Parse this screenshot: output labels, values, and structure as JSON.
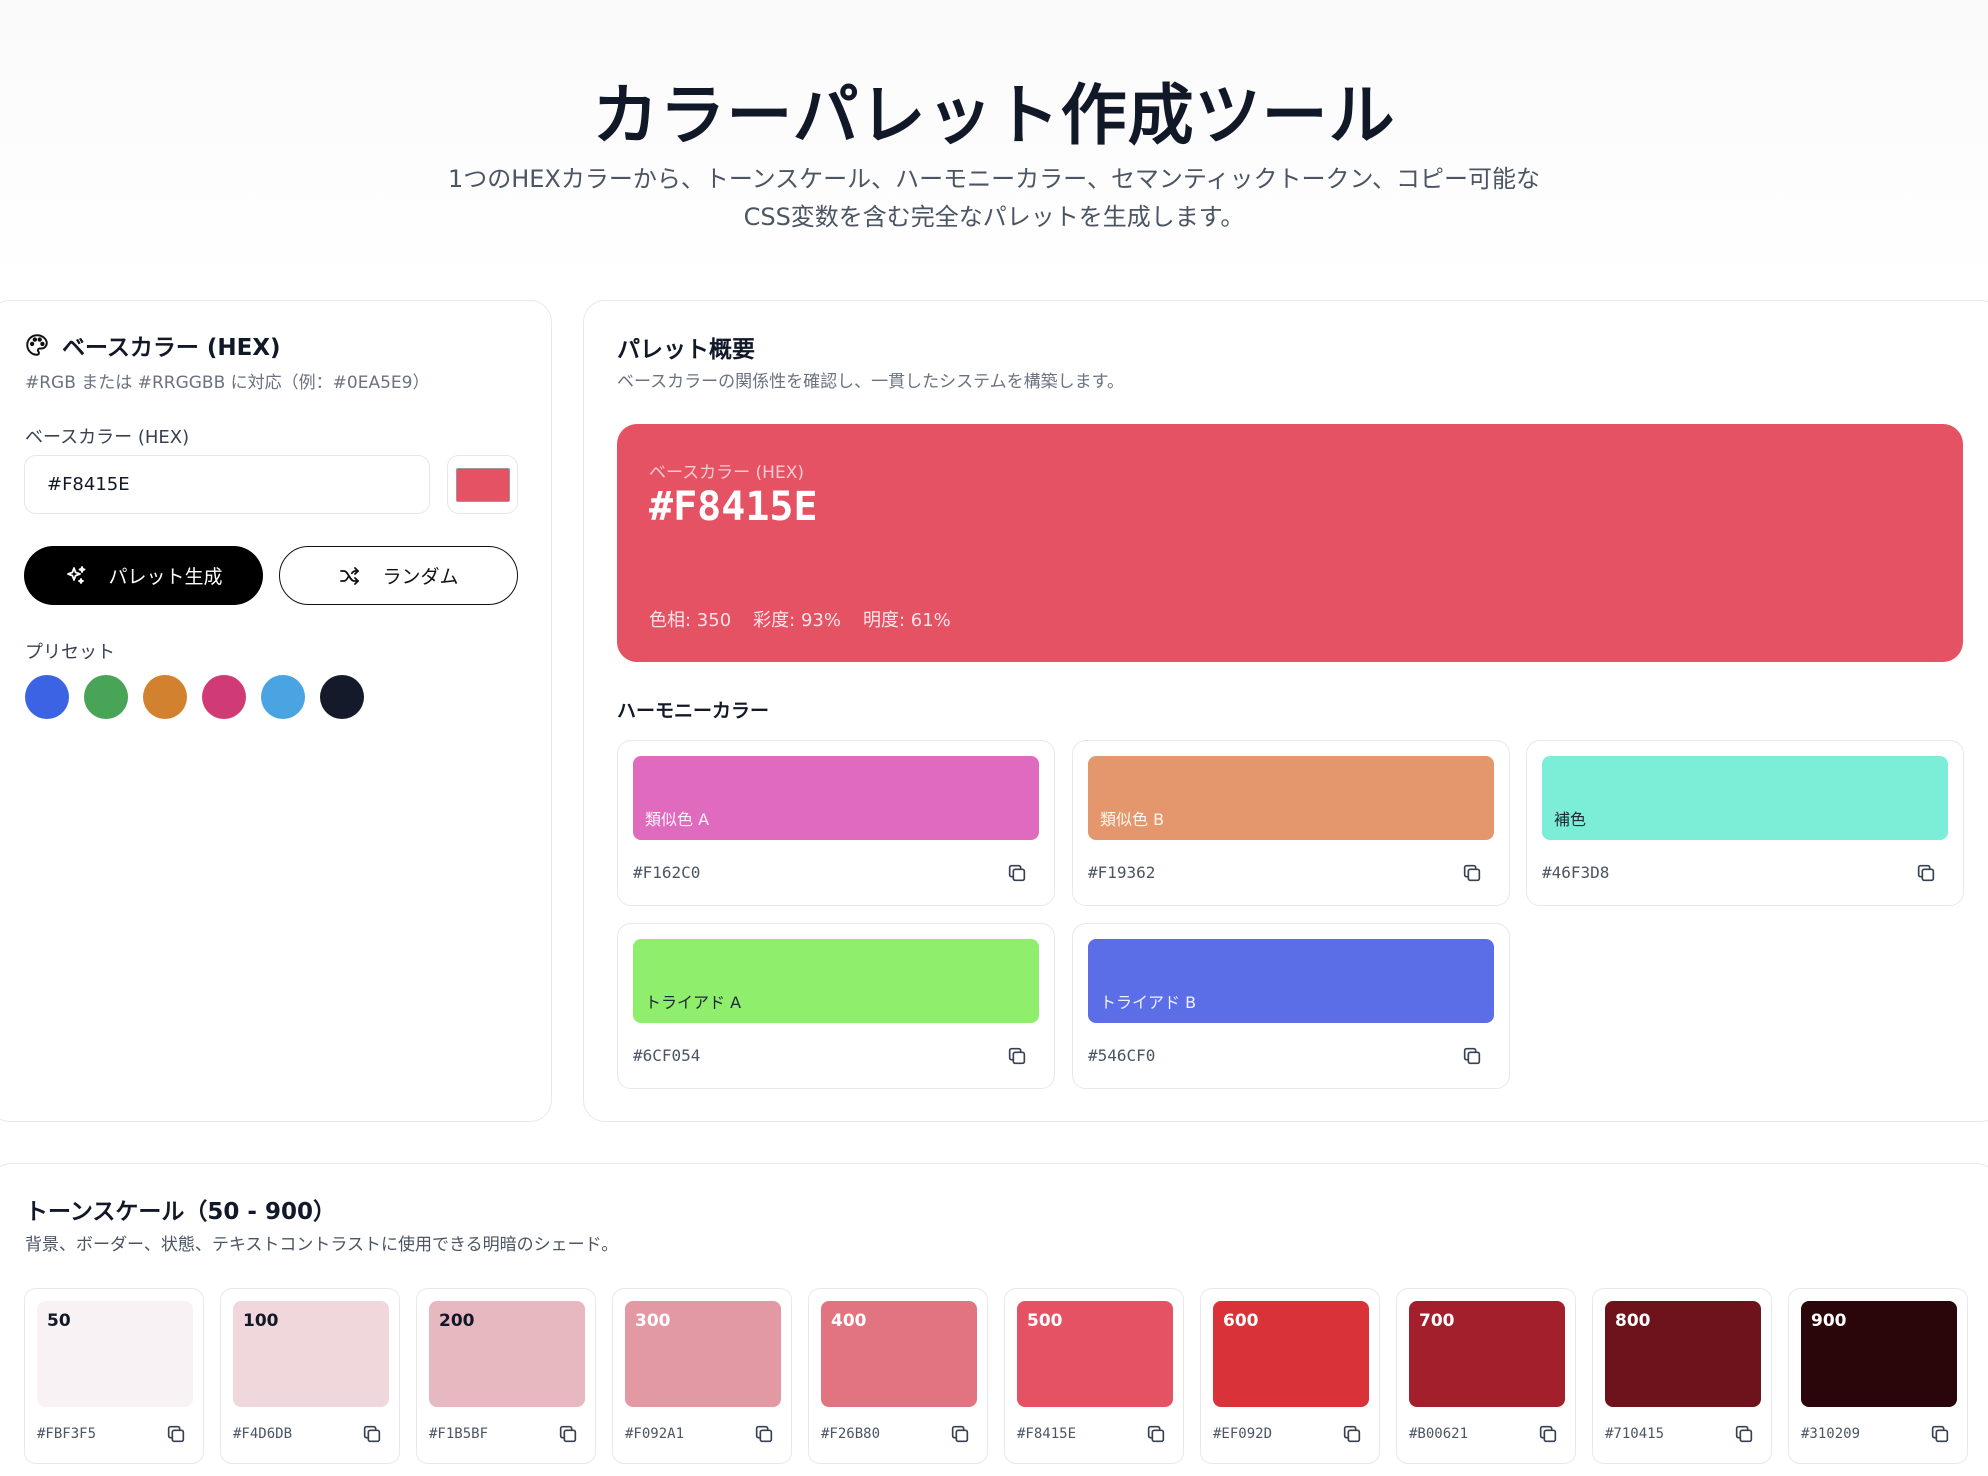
{
  "header": {
    "title": "カラーパレット作成ツール",
    "subtitle_line1": "1つのHEXカラーから、トーンスケール、ハーモニーカラー、セマンティックトークン、コピー可能な",
    "subtitle_line2": "CSS変数を含む完全なパレットを生成します。"
  },
  "input_panel": {
    "title": "ベースカラー (HEX)",
    "subtitle": "#RGB または #RRGGBB に対応（例：#0EA5E9）",
    "field_label": "ベースカラー (HEX)",
    "hex_value": "#F8415E",
    "generate_label": "パレット生成",
    "random_label": "ランダム",
    "presets_label": "プリセット",
    "presets": [
      "#3B63E3",
      "#48A456",
      "#D2812E",
      "#D03A75",
      "#4BA4E2",
      "#141A2A"
    ]
  },
  "overview": {
    "title": "パレット概要",
    "subtitle": "ベースカラーの関係性を確認し、一貫したシステムを構築します。",
    "base_label": "ベースカラー (HEX)",
    "base_hex": "#F8415E",
    "base_color": "#E55264",
    "hue": "色相: 350",
    "saturation": "彩度: 93%",
    "lightness": "明度: 61%"
  },
  "harmony": {
    "title": "ハーモニーカラー",
    "items": [
      {
        "label": "類似色 A",
        "hex": "#F162C0",
        "color": "#E06ABE",
        "text_color": "#fdf2fa"
      },
      {
        "label": "類似色 B",
        "hex": "#F19362",
        "color": "#E4976C",
        "text_color": "#fdf5ef"
      },
      {
        "label": "補色",
        "hex": "#46F3D8",
        "color": "#7CEED8",
        "text_color": "#1f2937"
      },
      {
        "label": "トライアド A",
        "hex": "#6CF054",
        "color": "#8FEE6C",
        "text_color": "#1f2937"
      },
      {
        "label": "トライアド B",
        "hex": "#546CF0",
        "color": "#5B6EE8",
        "text_color": "#eef0ff"
      }
    ]
  },
  "tone_scale": {
    "title": "トーンスケール（50 - 900）",
    "subtitle": "背景、ボーダー、状態、テキストコントラストに使用できる明暗のシェード。",
    "items": [
      {
        "step": "50",
        "hex": "#FBF3F5",
        "color": "#F9F2F4",
        "text_color": "#111827"
      },
      {
        "step": "100",
        "hex": "#F4D6DB",
        "color": "#F0D7DB",
        "text_color": "#111827"
      },
      {
        "step": "200",
        "hex": "#F1B5BF",
        "color": "#E8B8C0",
        "text_color": "#111827"
      },
      {
        "step": "300",
        "hex": "#F092A1",
        "color": "#E299A4",
        "text_color": "#ffffff"
      },
      {
        "step": "400",
        "hex": "#F26B80",
        "color": "#E27482",
        "text_color": "#ffffff"
      },
      {
        "step": "500",
        "hex": "#F8415E",
        "color": "#E55264",
        "text_color": "#ffffff"
      },
      {
        "step": "600",
        "hex": "#EF092D",
        "color": "#D93339",
        "text_color": "#ffffff"
      },
      {
        "step": "700",
        "hex": "#B00621",
        "color": "#A21F2B",
        "text_color": "#ffffff"
      },
      {
        "step": "800",
        "hex": "#710415",
        "color": "#6E131B",
        "text_color": "#ffffff"
      },
      {
        "step": "900",
        "hex": "#310209",
        "color": "#2A0509",
        "text_color": "#ffffff"
      }
    ]
  }
}
